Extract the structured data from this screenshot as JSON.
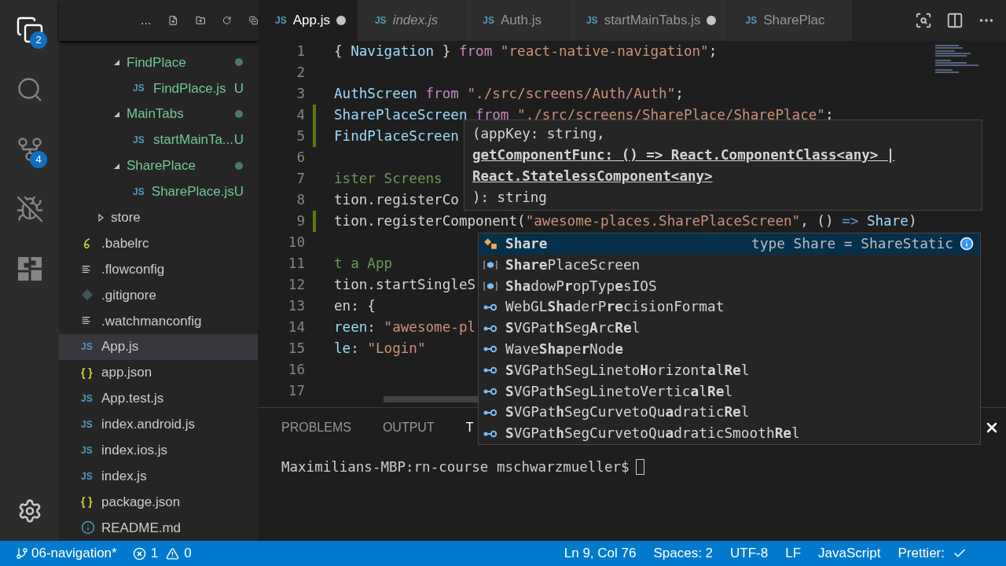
{
  "activity_bar": {
    "items": [
      {
        "kind": "files",
        "selected": true,
        "badge": "2"
      },
      {
        "kind": "search",
        "selected": false
      },
      {
        "kind": "source_control",
        "selected": false,
        "badge": "4"
      },
      {
        "kind": "debug",
        "selected": false
      },
      {
        "kind": "extensions",
        "selected": false
      }
    ]
  },
  "explorer": {
    "toolbar_more": "...",
    "tree": [
      {
        "kind": "offscreen_folder",
        "children": [
          {
            "kind": "offscreen_folder",
            "children": [
              {
                "kind": "folder",
                "name": "FindPlace",
                "expanded": true,
                "modified": true,
                "children": [
                  {
                    "kind": "js",
                    "icon": "JS",
                    "name": "FindPlace.js",
                    "status": "U"
                  }
                ]
              },
              {
                "kind": "folder",
                "name": "MainTabs",
                "expanded": true,
                "modified": true,
                "children": [
                  {
                    "kind": "js",
                    "icon": "JS",
                    "name": "startMainTa...",
                    "status": "U"
                  }
                ]
              },
              {
                "kind": "folder",
                "name": "SharePlace",
                "expanded": true,
                "modified": true,
                "children": [
                  {
                    "kind": "js",
                    "icon": "JS",
                    "name": "SharePlace.js",
                    "status": "U"
                  }
                ]
              }
            ]
          },
          {
            "kind": "folder",
            "name": "store",
            "expanded": false,
            "modified": false
          }
        ]
      },
      {
        "kind": "babel",
        "name": ".babelrc",
        "selected": false
      },
      {
        "kind": "lines",
        "name": ".flowconfig",
        "selected": false
      },
      {
        "kind": "git",
        "name": ".gitignore",
        "selected": false
      },
      {
        "kind": "lines",
        "name": ".watchmanconfig",
        "selected": false
      },
      {
        "kind": "js",
        "icon": "JS",
        "name": "App.js",
        "selected": true
      },
      {
        "kind": "json",
        "icon": "{ }",
        "name": "app.json",
        "selected": false
      },
      {
        "kind": "js",
        "icon": "JS",
        "name": "App.test.js",
        "selected": false
      },
      {
        "kind": "js",
        "icon": "JS",
        "name": "index.android.js",
        "selected": false
      },
      {
        "kind": "js",
        "icon": "JS",
        "name": "index.ios.js",
        "selected": false
      },
      {
        "kind": "js",
        "icon": "JS",
        "name": "index.js",
        "selected": false
      },
      {
        "kind": "json",
        "icon": "{ }",
        "name": "package.json",
        "selected": false
      },
      {
        "kind": "info",
        "name": "README.md",
        "selected": false
      }
    ]
  },
  "tabs": [
    {
      "icon": "JS",
      "label": "App.js",
      "selected": true,
      "dirty": true,
      "preview": false
    },
    {
      "icon": "JS",
      "label": "index.js",
      "selected": false,
      "dirty": false,
      "preview": true
    },
    {
      "icon": "JS",
      "label": "Auth.js",
      "selected": false,
      "dirty": false,
      "preview": false
    },
    {
      "icon": "JS",
      "label": "startMainTabs.js",
      "selected": false,
      "dirty": true,
      "preview": false
    },
    {
      "icon": "JS",
      "label": "SharePlac",
      "selected": false,
      "dirty": false,
      "preview": false
    }
  ],
  "code_lines": [
    {
      "number": "1",
      "changed": false,
      "tokens": [
        {
          "text": "{ ",
          "kind": "plain"
        },
        {
          "text": "Navigation",
          "kind": "ident"
        },
        {
          "text": " } ",
          "kind": "plain"
        },
        {
          "text": "from",
          "kind": "keyword"
        },
        {
          "text": " \"react-native-navigation\"",
          "kind": "string"
        },
        {
          "text": ";",
          "kind": "plain"
        }
      ]
    },
    {
      "number": "2",
      "changed": false
    },
    {
      "number": "3",
      "changed": false,
      "tokens": [
        {
          "text": "AuthScreen",
          "kind": "ident"
        },
        {
          "text": " from",
          "kind": "keyword"
        },
        {
          "text": " \"./src/screens/Auth/Auth\"",
          "kind": "string"
        },
        {
          "text": ";",
          "kind": "plain"
        }
      ]
    },
    {
      "number": "4",
      "changed": true,
      "tokens": [
        {
          "text": "SharePlaceScreen",
          "kind": "ident"
        },
        {
          "text": " from",
          "kind": "keyword"
        },
        {
          "text": " \"./src/screens/SharePlace/SharePlace\"",
          "kind": "string"
        },
        {
          "text": ";",
          "kind": "plain"
        }
      ]
    },
    {
      "number": "5",
      "changed": true,
      "tokens": [
        {
          "text": "FindPlaceScreen",
          "kind": "ident"
        }
      ]
    },
    {
      "number": "6",
      "changed": false
    },
    {
      "number": "7",
      "changed": false,
      "tokens": [
        {
          "text": "ister Screens",
          "kind": "comment"
        }
      ]
    },
    {
      "number": "8",
      "changed": false,
      "tokens": [
        {
          "text": "tion.registerCo",
          "kind": "plain"
        }
      ]
    },
    {
      "number": "9",
      "changed": true,
      "tokens": [
        {
          "text": "tion.registerComponent(",
          "kind": "plain"
        },
        {
          "text": "\"awesome-places.SharePlaceScreen\"",
          "kind": "string"
        },
        {
          "text": ", () ",
          "kind": "plain"
        },
        {
          "text": "=>",
          "kind": "operator"
        },
        {
          "text": " Share",
          "kind": "ident"
        },
        {
          "text": ")",
          "kind": "plain"
        }
      ]
    },
    {
      "number": "10",
      "changed": false
    },
    {
      "number": "11",
      "changed": false,
      "tokens": [
        {
          "text": "t a App",
          "kind": "comment"
        }
      ]
    },
    {
      "number": "12",
      "changed": false,
      "tokens": [
        {
          "text": "tion.startSingleS",
          "kind": "plain"
        }
      ]
    },
    {
      "number": "13",
      "changed": false,
      "tokens": [
        {
          "text": "en: {",
          "kind": "plain"
        }
      ]
    },
    {
      "number": "14",
      "changed": false,
      "tokens": [
        {
          "text": "reen: ",
          "kind": "ident"
        },
        {
          "text": "\"awesome-pl",
          "kind": "string"
        }
      ]
    },
    {
      "number": "15",
      "changed": false,
      "tokens": [
        {
          "text": "le: ",
          "kind": "ident"
        },
        {
          "text": "\"Login\"",
          "kind": "string"
        }
      ]
    },
    {
      "number": "16",
      "changed": false
    },
    {
      "number": "17",
      "changed": false
    }
  ],
  "signature_hover": [
    {
      "text": "(appKey: string,",
      "emphasis": false
    },
    {
      "text": "getComponentFunc: () => React.ComponentClass<any> |",
      "emphasis": true
    },
    {
      "text": "React.StatelessComponent<any>",
      "emphasis": true
    },
    {
      "text": "): string",
      "emphasis": false
    }
  ],
  "suggestions": [
    {
      "kind": "type",
      "label": "**Share**",
      "selected": true,
      "detail": "type Share = ShareStatic"
    },
    {
      "kind": "variable",
      "label": "**Share**PlaceScreen",
      "selected": false
    },
    {
      "kind": "variable",
      "label": "**Sha**dowP**r**opTyp**e**sIOS",
      "selected": false
    },
    {
      "kind": "interface",
      "label": "WebGL**Sha**derP**re**cisionFormat",
      "selected": false
    },
    {
      "kind": "interface",
      "label": "**S**VGPat**h**Seg**A**rc**Re**l",
      "selected": false
    },
    {
      "kind": "interface",
      "label": "Wave**Sha**pe**r**Nod**e**",
      "selected": false
    },
    {
      "kind": "interface",
      "label": "**S**VGPathSegLineto**H**orizont**a**l**Re**l",
      "selected": false
    },
    {
      "kind": "interface",
      "label": "**S**VGPat**h**SegLinetoVertic**a**l**Re**l",
      "selected": false
    },
    {
      "kind": "interface",
      "label": "**S**VGPat**h**SegCurvetoQu**a**dratic**Re**l",
      "selected": false
    },
    {
      "kind": "interface",
      "label": "**S**VGPat**h**SegCurvetoQu**a**draticSmooth**Re**l",
      "selected": false
    }
  ],
  "panel": {
    "tabs": [
      {
        "label": "PROBLEMS",
        "selected": false
      },
      {
        "label": "OUTPUT",
        "selected": false
      },
      {
        "label": "T",
        "selected": true
      }
    ],
    "terminal_prompt": "Maximilians-MBP:rn-course mschwarzmueller$"
  },
  "status_bar": {
    "branch": "06-navigation*",
    "errors": "1",
    "warnings": "0",
    "items": [
      "Ln 9, Col 76",
      "Spaces: 2",
      "UTF-8",
      "LF",
      "JavaScript",
      "Prettier:"
    ]
  }
}
